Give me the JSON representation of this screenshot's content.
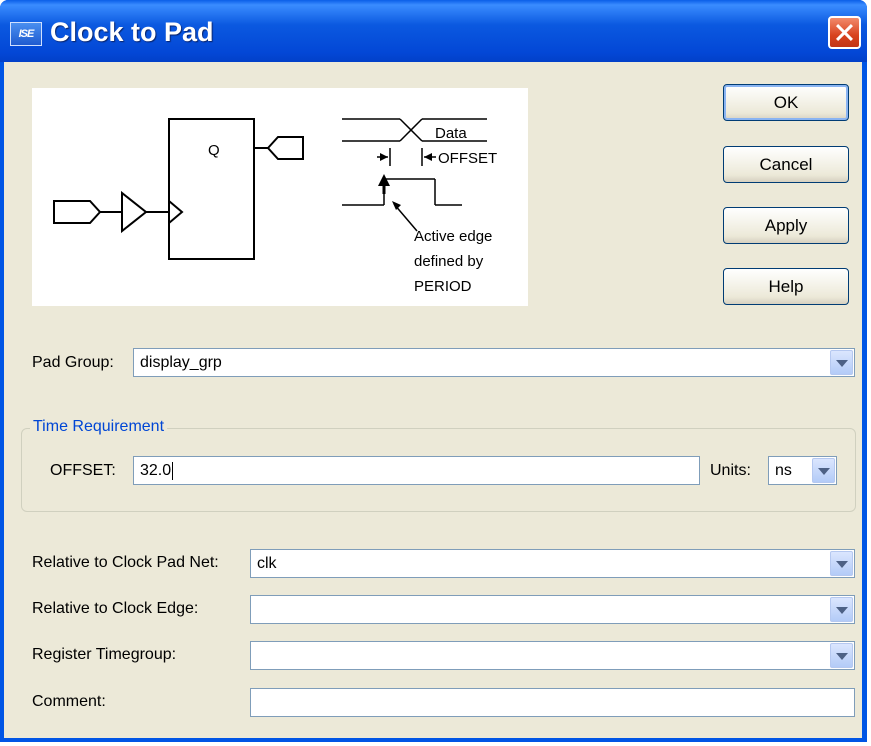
{
  "window": {
    "title": "Clock to Pad",
    "app_icon": "ISE"
  },
  "diagram": {
    "flop_output_label": "Q",
    "data_label": "Data",
    "offset_label": "OFFSET",
    "edge_note_line1": "Active edge",
    "edge_note_line2": "defined by",
    "edge_note_line3": "PERIOD"
  },
  "buttons": {
    "ok": "OK",
    "cancel": "Cancel",
    "apply": "Apply",
    "help": "Help"
  },
  "pad_group": {
    "label": "Pad Group:",
    "value": "display_grp"
  },
  "time_requirement": {
    "title": "Time Requirement",
    "offset_label": "OFFSET:",
    "offset_value": "32.0",
    "units_label": "Units:",
    "units_value": "ns"
  },
  "clock_pad_net": {
    "label": "Relative to Clock Pad Net:",
    "value": "clk"
  },
  "clock_edge": {
    "label": "Relative to Clock Edge:",
    "value": ""
  },
  "register_timegroup": {
    "label": "Register Timegroup:",
    "value": ""
  },
  "comment": {
    "label": "Comment:",
    "value": ""
  },
  "colors": {
    "title_bar": "#0055e5",
    "dialog_bg": "#ece9d8",
    "group_title": "#0046d5",
    "close_button": "#d8421e"
  }
}
